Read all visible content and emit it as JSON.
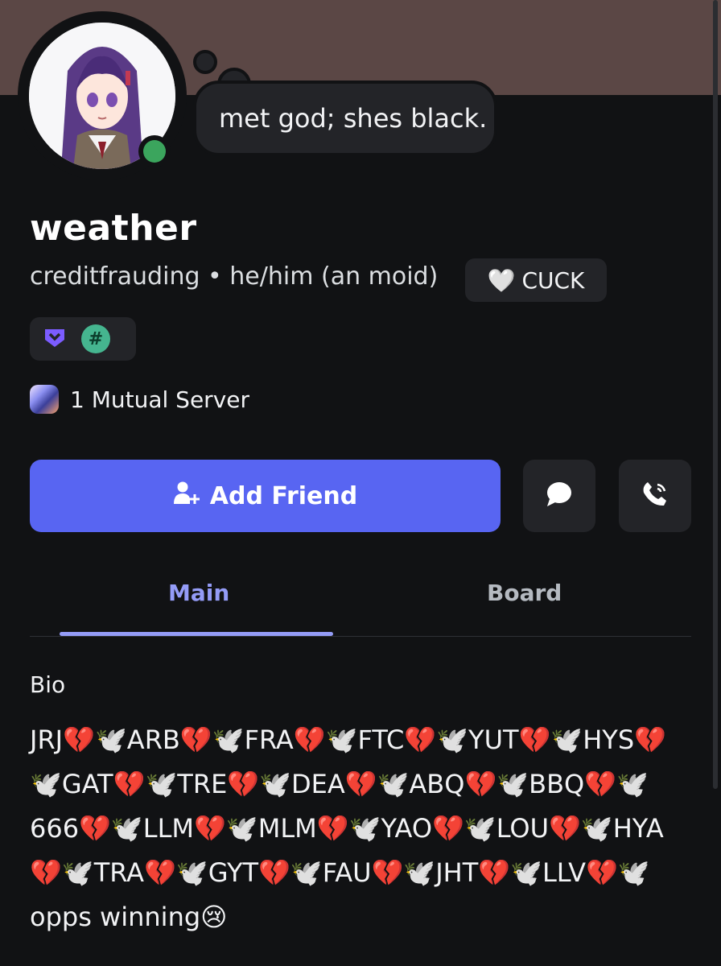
{
  "status": {
    "text": "met god; shes black."
  },
  "profile": {
    "display_name": "weather",
    "username": "creditfrauding",
    "separator": "•",
    "pronouns": "he/him (an moid)",
    "tag": {
      "emoji": "🤍",
      "label": "CUCK"
    },
    "badges": [
      {
        "name": "hypesquad-icon"
      },
      {
        "name": "hash-badge-icon",
        "glyph": "#"
      }
    ],
    "mutual_servers": "1 Mutual Server"
  },
  "actions": {
    "add_friend": "Add Friend",
    "message_icon": "chat-bubble-icon",
    "call_icon": "phone-call-icon"
  },
  "tabs": [
    {
      "label": "Main",
      "active": true
    },
    {
      "label": "Board",
      "active": false
    }
  ],
  "bio": {
    "label": "Bio",
    "text": "JRJ💔🕊️ARB💔🕊️FRA💔🕊️FTC💔🕊️YUT💔🕊️HYS💔🕊️GAT💔🕊️TRE💔🕊️DEA💔🕊️ABQ💔🕊️BBQ💔🕊️666💔🕊️LLM💔🕊️MLM💔🕊️YAO💔🕊️LOU💔🕊️HYA💔🕊️TRA💔🕊️GYT💔🕊️FAU💔🕊️JHT💔🕊️LLV💔🕊️opps winning😢"
  },
  "colors": {
    "accent": "#5865f2",
    "tab_active": "#949cf7",
    "online": "#3ba55d",
    "banner": "#5b4745",
    "background": "#111214"
  }
}
